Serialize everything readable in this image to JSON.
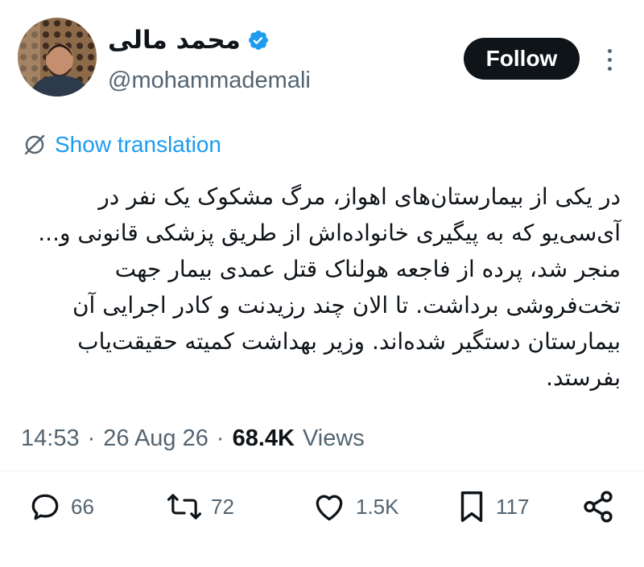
{
  "author": {
    "display_name": "محمد مالی",
    "handle": "@mohammademali"
  },
  "follow_label": "Follow",
  "translation_label": "Show translation",
  "tweet_text": "در یکی از بیمارستان‌های اهواز، مرگ مشکوک یک نفر در آی‌سی‌یو که به پیگیری خانواده‌اش از طریق پزشکی قانونی و... منجر شد، پرده از فاجعه هولناک قتل عمدی بیمار جهت تخت‌فروشی برداشت. تا الان چند رزیدنت و کادر اجرایی آن بیمارستان دستگیر شده‌اند. وزیر بهداشت کمیته حقیقت‌یاب بفرستد.",
  "meta": {
    "time": "14:53",
    "date": "26 Aug 26",
    "separator": "·",
    "views_count": "68.4K",
    "views_label": "Views"
  },
  "actions": {
    "replies": "66",
    "reposts": "72",
    "likes": "1.5K",
    "bookmarks": "117"
  },
  "icons": [
    "verified-badge-icon",
    "translate-globe-icon",
    "more-icon",
    "reply-icon",
    "repost-icon",
    "like-icon",
    "bookmark-icon",
    "share-icon"
  ],
  "colors": {
    "accent": "#1d9bf0",
    "text": "#0f1419",
    "muted": "#536471",
    "button": "#0f1419"
  }
}
